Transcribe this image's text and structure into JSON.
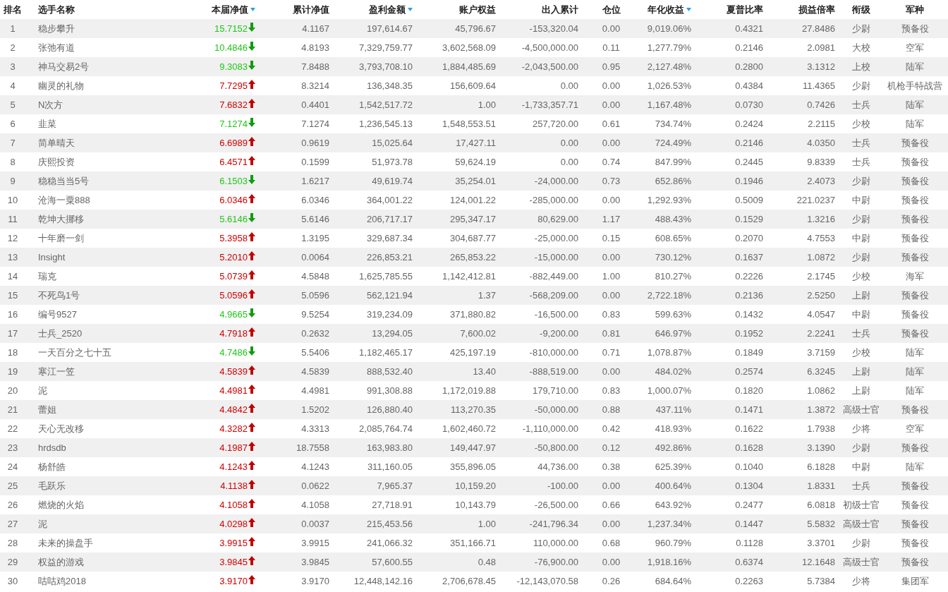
{
  "table": {
    "columns": [
      {
        "label": "排名",
        "sort_indicator": false
      },
      {
        "label": "选手名称",
        "sort_indicator": false
      },
      {
        "label": "本届净值",
        "sort_indicator": true
      },
      {
        "label": "累计净值",
        "sort_indicator": false
      },
      {
        "label": "盈利金额",
        "sort_indicator": true
      },
      {
        "label": "账户权益",
        "sort_indicator": false
      },
      {
        "label": "出入累计",
        "sort_indicator": false
      },
      {
        "label": "仓位",
        "sort_indicator": false
      },
      {
        "label": "年化收益",
        "sort_indicator": true
      },
      {
        "label": "夏普比率",
        "sort_indicator": false
      },
      {
        "label": "损益倍率",
        "sort_indicator": false
      },
      {
        "label": "衔级",
        "sort_indicator": false
      },
      {
        "label": "军种",
        "sort_indicator": false
      }
    ],
    "rows": [
      {
        "rising": false,
        "cells": [
          "1",
          "稳步攀升",
          "15.7152",
          "4.1167",
          "197,614.67",
          "45,796.67",
          "-153,320.04",
          "0.00",
          "9,019.06%",
          "0.4321",
          "27.8486",
          "少尉",
          "预备役"
        ]
      },
      {
        "rising": false,
        "cells": [
          "2",
          "张弛有道",
          "10.4846",
          "4.8193",
          "7,329,759.77",
          "3,602,568.09",
          "-4,500,000.00",
          "0.11",
          "1,277.79%",
          "0.2146",
          "2.0981",
          "大校",
          "空军"
        ]
      },
      {
        "rising": false,
        "cells": [
          "3",
          "神马交易2号",
          "9.3083",
          "7.8488",
          "3,793,708.10",
          "1,884,485.69",
          "-2,043,500.00",
          "0.95",
          "2,127.48%",
          "0.2800",
          "3.1312",
          "上校",
          "陆军"
        ]
      },
      {
        "rising": true,
        "cells": [
          "4",
          "幽灵的礼物",
          "7.7295",
          "8.3214",
          "136,348.35",
          "156,609.64",
          "0.00",
          "0.00",
          "1,026.53%",
          "0.4384",
          "11.4365",
          "少尉",
          "机枪手特战营"
        ]
      },
      {
        "rising": true,
        "cells": [
          "5",
          "N次方",
          "7.6832",
          "0.4401",
          "1,542,517.72",
          "1.00",
          "-1,733,357.71",
          "0.00",
          "1,167.48%",
          "0.0730",
          "0.7426",
          "士兵",
          "陆军"
        ]
      },
      {
        "rising": false,
        "cells": [
          "6",
          "韭菜",
          "7.1274",
          "7.1274",
          "1,236,545.13",
          "1,548,553.51",
          "257,720.00",
          "0.61",
          "734.74%",
          "0.2424",
          "2.2115",
          "少校",
          "陆军"
        ]
      },
      {
        "rising": true,
        "cells": [
          "7",
          "简单晴天",
          "6.6989",
          "0.9619",
          "15,025.64",
          "17,427.11",
          "0.00",
          "0.00",
          "724.49%",
          "0.2146",
          "4.0350",
          "士兵",
          "预备役"
        ]
      },
      {
        "rising": true,
        "cells": [
          "8",
          "庆熙投资",
          "6.4571",
          "0.1599",
          "51,973.78",
          "59,624.19",
          "0.00",
          "0.74",
          "847.99%",
          "0.2445",
          "9.8339",
          "士兵",
          "预备役"
        ]
      },
      {
        "rising": false,
        "cells": [
          "9",
          "稳稳当当5号",
          "6.1503",
          "1.6217",
          "49,619.74",
          "35,254.01",
          "-24,000.00",
          "0.73",
          "652.86%",
          "0.1946",
          "2.4073",
          "少尉",
          "预备役"
        ]
      },
      {
        "rising": true,
        "cells": [
          "10",
          "沧海一粟888",
          "6.0346",
          "6.0346",
          "364,001.22",
          "124,001.22",
          "-285,000.00",
          "0.00",
          "1,292.93%",
          "0.5009",
          "221.0237",
          "中尉",
          "预备役"
        ]
      },
      {
        "rising": false,
        "cells": [
          "11",
          "乾坤大挪移",
          "5.6146",
          "5.6146",
          "206,717.17",
          "295,347.17",
          "80,629.00",
          "1.17",
          "488.43%",
          "0.1529",
          "1.3216",
          "少尉",
          "预备役"
        ]
      },
      {
        "rising": true,
        "cells": [
          "12",
          "十年磨一剑",
          "5.3958",
          "1.3195",
          "329,687.34",
          "304,687.77",
          "-25,000.00",
          "0.15",
          "608.65%",
          "0.2070",
          "4.7553",
          "中尉",
          "预备役"
        ]
      },
      {
        "rising": true,
        "cells": [
          "13",
          "Insight",
          "5.2010",
          "0.0064",
          "226,853.21",
          "265,853.22",
          "-15,000.00",
          "0.00",
          "730.12%",
          "0.1637",
          "1.0872",
          "少尉",
          "预备役"
        ]
      },
      {
        "rising": true,
        "cells": [
          "14",
          "瑞克",
          "5.0739",
          "4.5848",
          "1,625,785.55",
          "1,142,412.81",
          "-882,449.00",
          "1.00",
          "810.27%",
          "0.2226",
          "2.1745",
          "少校",
          "海军"
        ]
      },
      {
        "rising": true,
        "cells": [
          "15",
          "不死鸟1号",
          "5.0596",
          "5.0596",
          "562,121.94",
          "1.37",
          "-568,209.00",
          "0.00",
          "2,722.18%",
          "0.2136",
          "2.5250",
          "上尉",
          "预备役"
        ]
      },
      {
        "rising": false,
        "cells": [
          "16",
          "编号9527",
          "4.9665",
          "9.5254",
          "319,234.09",
          "371,880.82",
          "-16,500.00",
          "0.83",
          "599.63%",
          "0.1432",
          "4.0547",
          "中尉",
          "预备役"
        ]
      },
      {
        "rising": true,
        "cells": [
          "17",
          "士兵_2520",
          "4.7918",
          "0.2632",
          "13,294.05",
          "7,600.02",
          "-9,200.00",
          "0.81",
          "646.97%",
          "0.1952",
          "2.2241",
          "士兵",
          "预备役"
        ]
      },
      {
        "rising": false,
        "cells": [
          "18",
          "一天百分之七十五",
          "4.7486",
          "5.5406",
          "1,182,465.17",
          "425,197.19",
          "-810,000.00",
          "0.71",
          "1,078.87%",
          "0.1849",
          "3.7159",
          "少校",
          "陆军"
        ]
      },
      {
        "rising": true,
        "cells": [
          "19",
          "寒江一笠",
          "4.5839",
          "4.5839",
          "888,532.40",
          "13.40",
          "-888,519.00",
          "0.00",
          "484.02%",
          "0.2574",
          "6.3245",
          "上尉",
          "陆军"
        ]
      },
      {
        "rising": true,
        "cells": [
          "20",
          "泥",
          "4.4981",
          "4.4981",
          "991,308.88",
          "1,172,019.88",
          "179,710.00",
          "0.83",
          "1,000.07%",
          "0.1820",
          "1.0862",
          "上尉",
          "陆军"
        ]
      },
      {
        "rising": true,
        "cells": [
          "21",
          "蕾姐",
          "4.4842",
          "1.5202",
          "126,880.40",
          "113,270.35",
          "-50,000.00",
          "0.88",
          "437.11%",
          "0.1471",
          "1.3872",
          "高级士官",
          "预备役"
        ]
      },
      {
        "rising": true,
        "cells": [
          "22",
          "天心无改移",
          "4.3282",
          "4.3313",
          "2,085,764.74",
          "1,602,460.72",
          "-1,110,000.00",
          "0.42",
          "418.93%",
          "0.1622",
          "1.7938",
          "少将",
          "空军"
        ]
      },
      {
        "rising": true,
        "cells": [
          "23",
          "hrdsdb",
          "4.1987",
          "18.7558",
          "163,983.80",
          "149,447.97",
          "-50,800.00",
          "0.12",
          "492.86%",
          "0.1628",
          "3.1390",
          "少尉",
          "预备役"
        ]
      },
      {
        "rising": true,
        "cells": [
          "24",
          "杨舒皓",
          "4.1243",
          "4.1243",
          "311,160.05",
          "355,896.05",
          "44,736.00",
          "0.38",
          "625.39%",
          "0.1040",
          "6.1828",
          "中尉",
          "陆军"
        ]
      },
      {
        "rising": true,
        "cells": [
          "25",
          "毛跃乐",
          "4.1138",
          "0.0622",
          "7,965.37",
          "10,159.20",
          "-100.00",
          "0.00",
          "400.64%",
          "0.1304",
          "1.8331",
          "士兵",
          "预备役"
        ]
      },
      {
        "rising": true,
        "cells": [
          "26",
          "燃烧的火焰",
          "4.1058",
          "4.1058",
          "27,718.91",
          "10,143.79",
          "-26,500.00",
          "0.66",
          "643.92%",
          "0.2477",
          "6.0818",
          "初级士官",
          "预备役"
        ]
      },
      {
        "rising": true,
        "cells": [
          "27",
          "泥",
          "4.0298",
          "0.0037",
          "215,453.56",
          "1.00",
          "-241,796.34",
          "0.00",
          "1,237.34%",
          "0.1447",
          "5.5832",
          "高级士官",
          "预备役"
        ]
      },
      {
        "rising": true,
        "cells": [
          "28",
          "未来的操盘手",
          "3.9915",
          "3.9915",
          "241,066.32",
          "351,166.71",
          "110,000.00",
          "0.68",
          "960.79%",
          "0.1128",
          "3.3701",
          "少尉",
          "预备役"
        ]
      },
      {
        "rising": true,
        "cells": [
          "29",
          "权益的游戏",
          "3.9845",
          "3.9845",
          "57,600.55",
          "0.48",
          "-76,900.00",
          "0.00",
          "1,918.16%",
          "0.6374",
          "12.1648",
          "高级士官",
          "预备役"
        ]
      },
      {
        "rising": true,
        "cells": [
          "30",
          "咕咕鸡2018",
          "3.9170",
          "3.9170",
          "12,448,142.16",
          "2,706,678.45",
          "-12,143,070.58",
          "0.26",
          "684.64%",
          "0.2263",
          "5.7384",
          "少将",
          "集团军"
        ]
      }
    ]
  }
}
